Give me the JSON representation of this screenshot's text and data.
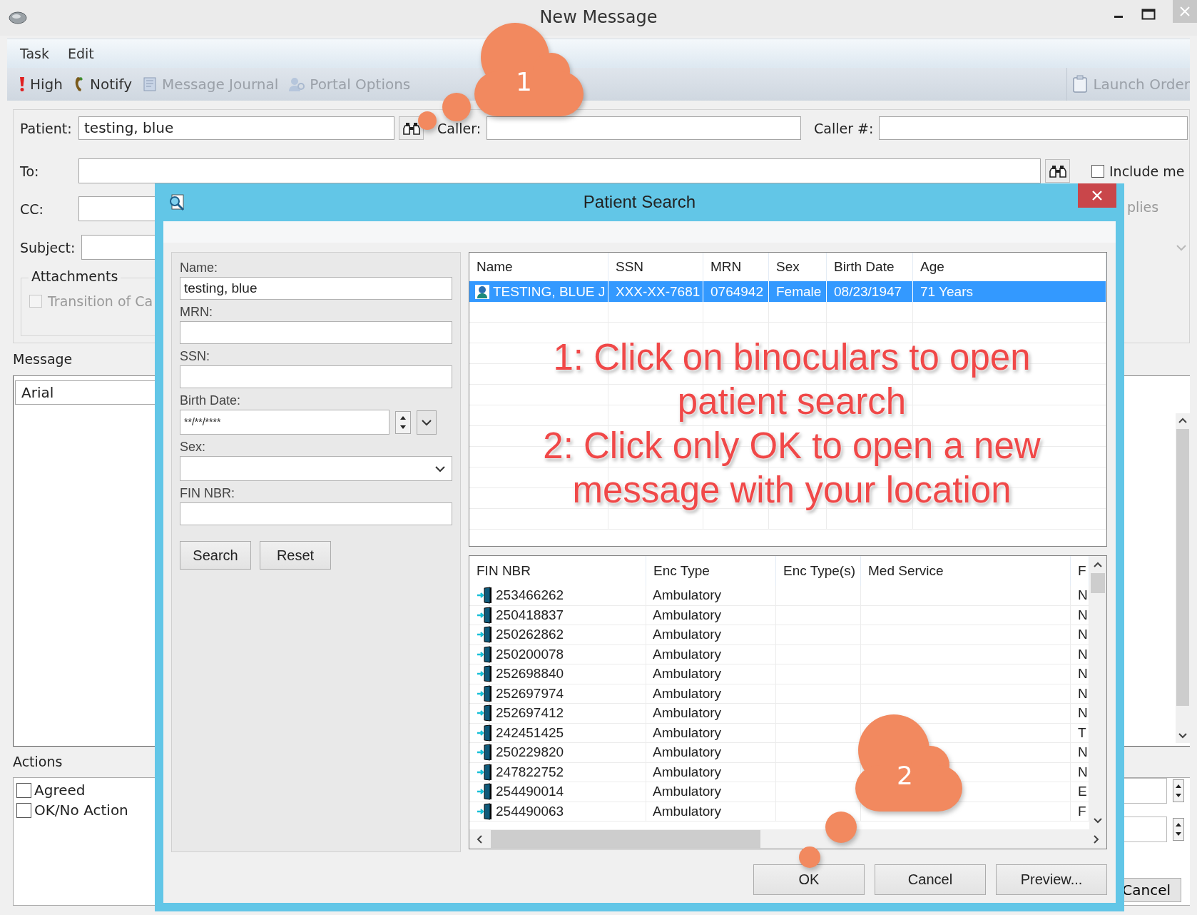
{
  "window": {
    "title": "New Message"
  },
  "menu": [
    "Task",
    "Edit"
  ],
  "toolbar": [
    {
      "label": "High",
      "kind": "priority",
      "disabled": false
    },
    {
      "label": "Notify",
      "kind": "notify",
      "disabled": false
    },
    {
      "label": "Message Journal",
      "kind": "journal",
      "disabled": true
    },
    {
      "label": "Portal Options",
      "kind": "portal",
      "disabled": true
    }
  ],
  "toolbar_right": [
    {
      "label": "Launch Order",
      "kind": "orders",
      "disabled": true
    }
  ],
  "form": {
    "patient": {
      "label": "Patient:",
      "value": "testing, blue"
    },
    "caller": {
      "label": "Caller:"
    },
    "caller_number": {
      "label": "Caller #:"
    },
    "to": {
      "label": "To:"
    },
    "include_me": {
      "label": "Include me",
      "checked": false
    },
    "cc": {
      "label": "CC:"
    },
    "replies_fragment": "plies",
    "subject": {
      "label": "Subject:"
    },
    "attachments": {
      "title": "Attachments",
      "items": [
        {
          "label": "Transition of Ca",
          "checked": false,
          "disabled": true
        }
      ]
    }
  },
  "message": {
    "title": "Message",
    "font": "Arial"
  },
  "actions": {
    "title": "Actions",
    "items": [
      {
        "label": "Agreed",
        "checked": false
      },
      {
        "label": "OK/No Action",
        "checked": false
      }
    ]
  },
  "footer_buttons": [
    "Cancel"
  ],
  "dialog": {
    "title": "Patient Search",
    "criteria": [
      {
        "label": "Name:",
        "kind": "text",
        "value": "testing, blue"
      },
      {
        "label": "MRN:",
        "kind": "text"
      },
      {
        "label": "SSN:",
        "kind": "text"
      },
      {
        "label": "Birth Date:",
        "kind": "date",
        "value": "**/**/****"
      },
      {
        "label": "Sex:",
        "kind": "select"
      },
      {
        "label": "FIN NBR:",
        "kind": "text"
      }
    ],
    "search_buttons": [
      "Search",
      "Reset"
    ],
    "patients": {
      "columns": [
        "Name",
        "SSN",
        "MRN",
        "Sex",
        "Birth Date",
        "Age"
      ],
      "rows": [
        {
          "cells": [
            "TESTING, BLUE J",
            "XXX-XX-7681",
            "0764942",
            "Female",
            "08/23/1947",
            "71 Years"
          ],
          "selected": true
        }
      ]
    },
    "encounters": {
      "columns": [
        "FIN NBR",
        "Enc Type",
        "Enc Type(s)",
        "Med Service",
        "F"
      ],
      "rows": [
        {
          "fin": "253466262",
          "enc_type": "Ambulatory",
          "column_5": "N",
          "selected": false
        },
        {
          "fin": "250418837",
          "enc_type": "Ambulatory",
          "column_5": "N",
          "selected": false
        },
        {
          "fin": "250262862",
          "enc_type": "Ambulatory",
          "column_5": "N",
          "selected": false
        },
        {
          "fin": "250200078",
          "enc_type": "Ambulatory",
          "column_5": "N",
          "selected": false
        },
        {
          "fin": "252698840",
          "enc_type": "Ambulatory",
          "column_5": "N",
          "selected": false
        },
        {
          "fin": "252697974",
          "enc_type": "Ambulatory",
          "column_5": "N",
          "selected": false
        },
        {
          "fin": "252697412",
          "enc_type": "Ambulatory",
          "column_5": "N",
          "selected": false
        },
        {
          "fin": "242451425",
          "enc_type": "Ambulatory",
          "column_5": "T",
          "selected": false
        },
        {
          "fin": "250229820",
          "enc_type": "Ambulatory",
          "column_5": "N",
          "selected": false
        },
        {
          "fin": "247822752",
          "enc_type": "Ambulatory",
          "column_5": "N",
          "selected": false
        },
        {
          "fin": "254490014",
          "enc_type": "Ambulatory",
          "column_5": "E",
          "selected": false
        },
        {
          "fin": "254490063",
          "enc_type": "Ambulatory",
          "column_5": "F",
          "selected": false
        }
      ]
    },
    "buttons": [
      "OK",
      "Cancel",
      "Preview..."
    ]
  },
  "annotation": {
    "lines": [
      "1: Click on binoculars to open",
      "patient search",
      "2: Click only OK to open a new",
      "message with your location"
    ]
  },
  "callouts": [
    {
      "label": "1"
    },
    {
      "label": "2"
    }
  ]
}
